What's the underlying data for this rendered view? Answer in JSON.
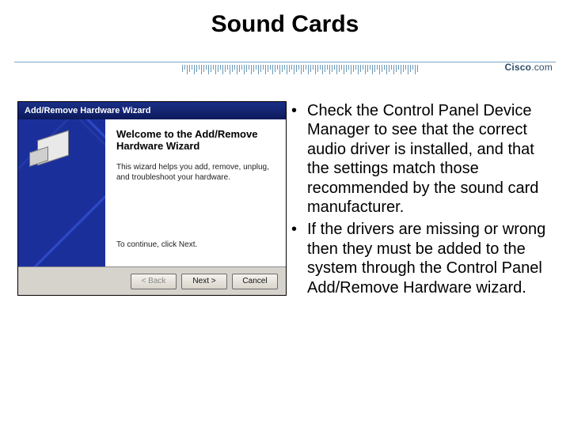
{
  "title": "Sound Cards",
  "brand": {
    "name": "Cisco",
    "suffix": ".com"
  },
  "wizard": {
    "titlebar": "Add/Remove Hardware Wizard",
    "heading": "Welcome to the Add/Remove Hardware Wizard",
    "description": "This wizard helps you add, remove, unplug, and troubleshoot your hardware.",
    "continue": "To continue, click Next.",
    "buttons": {
      "back": "< Back",
      "next": "Next >",
      "cancel": "Cancel"
    }
  },
  "bullets": [
    "Check the Control Panel Device Manager to see that the correct audio driver is installed, and that the settings match those recommended by the sound card manufacturer.",
    "If the drivers are missing or wrong then they must be added to the system through the Control Panel Add/Remove Hardware wizard."
  ]
}
